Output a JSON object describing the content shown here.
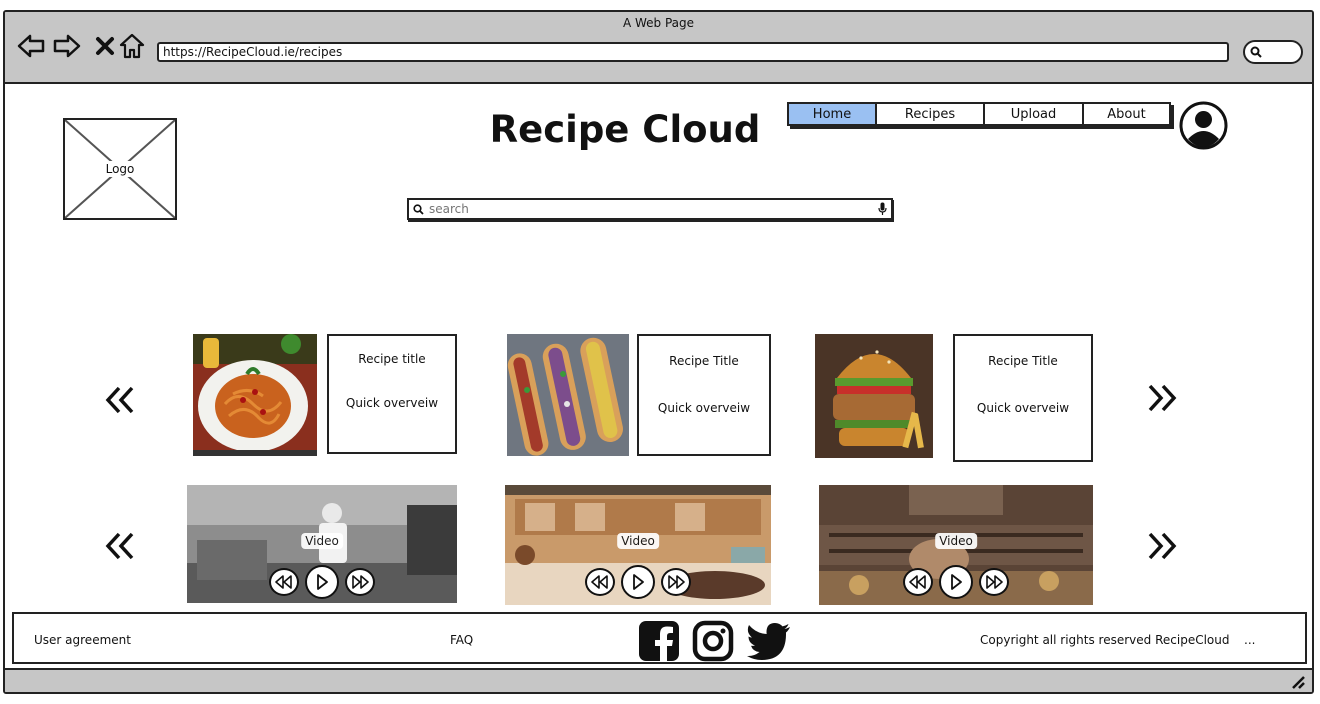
{
  "browser": {
    "window_title": "A Web Page",
    "url": "https://RecipeCloud.ie/recipes"
  },
  "header": {
    "logo_label": "Logo",
    "site_title": "Recipe Cloud",
    "nav": [
      {
        "label": "Home",
        "active": true
      },
      {
        "label": "Recipes",
        "active": false
      },
      {
        "label": "Upload",
        "active": false
      },
      {
        "label": "About",
        "active": false
      }
    ],
    "search_placeholder": "search"
  },
  "recipes": [
    {
      "title": "Recipe title",
      "overview": "Quick overveiw",
      "image": "spaghetti"
    },
    {
      "title": "Recipe Title",
      "overview": "Quick overveiw",
      "image": "hot-dogs"
    },
    {
      "title": "Recipe Title",
      "overview": "Quick overveiw",
      "image": "burger"
    }
  ],
  "videos": [
    {
      "label": "Video"
    },
    {
      "label": "Video"
    },
    {
      "label": "Video"
    }
  ],
  "footer": {
    "user_agreement": "User agreement",
    "faq": "FAQ",
    "copyright": "Copyright all rights reserved RecipeCloud",
    "more": "...",
    "social": [
      "facebook-icon",
      "instagram-icon",
      "twitter-icon"
    ]
  },
  "colors": {
    "chrome_bg": "#c6c6c6",
    "active_tab": "#9ac0f2"
  }
}
